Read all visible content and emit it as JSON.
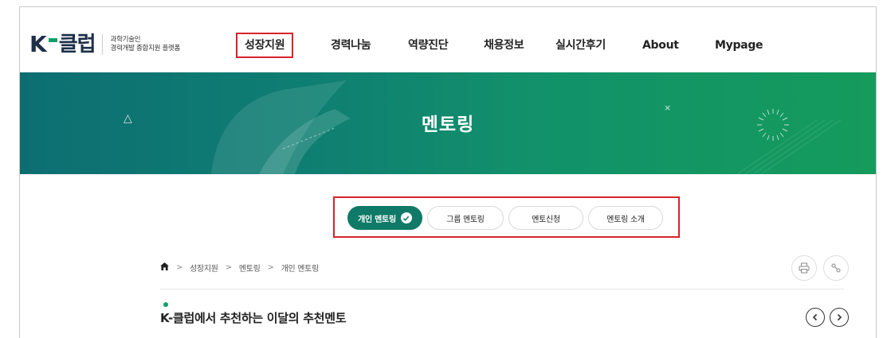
{
  "brand": {
    "logo_k": "K",
    "logo_word": "클럽",
    "subtitle_line1": "과학기술인",
    "subtitle_line2": "경력개발 종합지원 플랫폼"
  },
  "nav": {
    "items": [
      {
        "label": "성장지원",
        "highlighted": true
      },
      {
        "label": "경력나눔"
      },
      {
        "label": "역량진단"
      },
      {
        "label": "채용정보"
      },
      {
        "label": "실시간후기"
      },
      {
        "label": "About"
      },
      {
        "label": "Mypage"
      }
    ]
  },
  "banner": {
    "title": "멘토링",
    "close_glyph": "×",
    "triangle_glyph": "△"
  },
  "tabs": [
    {
      "label": "개인 멘토링",
      "active": true
    },
    {
      "label": "그룹 멘토링"
    },
    {
      "label": "멘토신청"
    },
    {
      "label": "멘토링 소개"
    }
  ],
  "breadcrumb": {
    "items": [
      "성장지원",
      "멘토링",
      "개인 멘토링"
    ],
    "separator": ">"
  },
  "section": {
    "title": "K-클럽에서 추천하는 이달의 추천멘토"
  },
  "colors": {
    "accent_green": "#13a06a",
    "active_tab": "#0f7a67",
    "highlight_red": "#d6232a",
    "brand_navy": "#1d2f49"
  },
  "icons": {
    "home": "home-icon",
    "print": "print-icon",
    "share": "share-icon",
    "prev": "chevron-left-icon",
    "next": "chevron-right-icon",
    "check": "check-icon"
  }
}
